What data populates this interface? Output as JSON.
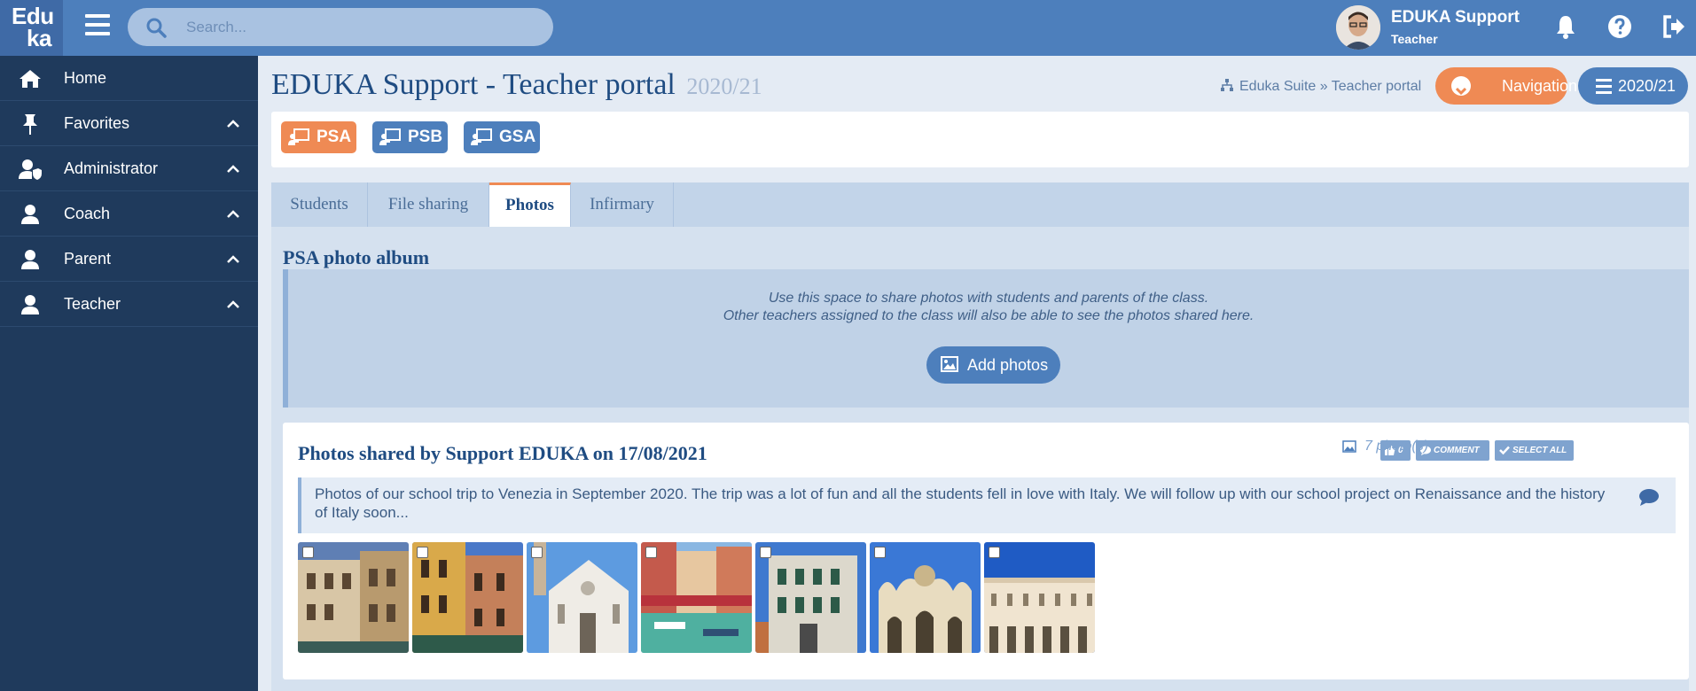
{
  "topbar": {
    "logo_line1": "Edu",
    "logo_line2": "ka",
    "search_placeholder": "Search...",
    "user_name": "EDUKA Support",
    "user_role": "Teacher"
  },
  "sidebar": {
    "items": [
      {
        "label": "Home",
        "icon": "home-icon"
      },
      {
        "label": "Favorites",
        "icon": "pin-icon"
      },
      {
        "label": "Administrator",
        "icon": "user-shield-icon"
      },
      {
        "label": "Coach",
        "icon": "user-icon"
      },
      {
        "label": "Parent",
        "icon": "user-icon"
      },
      {
        "label": "Teacher",
        "icon": "user-icon"
      }
    ]
  },
  "header": {
    "title": "EDUKA Support - Teacher portal",
    "year": "2020/21",
    "breadcrumb": "Eduka Suite » Teacher portal",
    "navigation_label": "Navigation",
    "year_button": "2020/21"
  },
  "classes": [
    {
      "label": "PSA",
      "color": "#ef8a54"
    },
    {
      "label": "PSB",
      "color": "#4d7fbc"
    },
    {
      "label": "GSA",
      "color": "#4d7fbc"
    }
  ],
  "tabs": [
    {
      "label": "Students"
    },
    {
      "label": "File sharing"
    },
    {
      "label": "Photos",
      "active": true
    },
    {
      "label": "Infirmary"
    }
  ],
  "album": {
    "title": "PSA photo album",
    "info_line1": "Use this space to share photos with students and parents of the class.",
    "info_line2": "Other teachers assigned to the class will also be able to see the photos shared here.",
    "add_button": "Add photos"
  },
  "post": {
    "title": "Photos shared by Support EDUKA on 17/08/2021",
    "likes": "0",
    "comment_label": "COMMENT",
    "select_all_label": "SELECT ALL",
    "photo_count": "7 photo(s)",
    "description": "Photos of our school trip to Venezia in September 2020. The trip was a lot of fun and all the students fell in love with Italy. We will follow up with our school project on Renaissance and the history of Italy soon..."
  },
  "colors": {
    "topbar": "#4d7fbc",
    "sidebar": "#1f3a5c",
    "accent": "#ef8a54"
  }
}
